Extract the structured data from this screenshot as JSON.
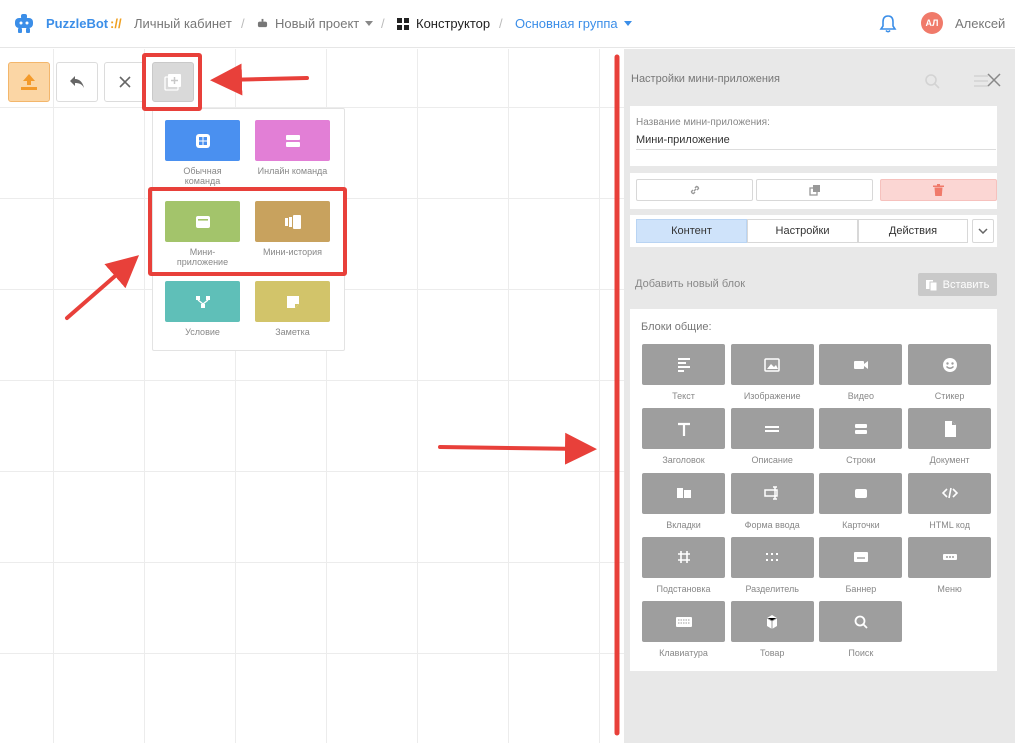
{
  "header": {
    "brand": "PuzzleBot",
    "brand_separator": "://",
    "breadcrumbs": [
      {
        "label": "Личный кабинет"
      },
      {
        "label": "Новый проект"
      },
      {
        "label": "Конструктор"
      },
      {
        "label": "Основная группа"
      }
    ],
    "avatar_initials": "АЛ",
    "user_name": "Алексей"
  },
  "palette": {
    "items": [
      {
        "label": "Обычная команда",
        "color": "#4a90f0",
        "icon": "grid-icon"
      },
      {
        "label": "Инлайн команда",
        "color": "#e27fd6",
        "icon": "inline-list-icon"
      },
      {
        "label": "Мини-приложение",
        "color": "#a3c46b",
        "icon": "window-icon"
      },
      {
        "label": "Мини-история",
        "color": "#c8a25e",
        "icon": "stories-icon"
      },
      {
        "label": "Условие",
        "color": "#5fbfb8",
        "icon": "branch-icon"
      },
      {
        "label": "Заметка",
        "color": "#d2c46a",
        "icon": "note-icon"
      }
    ]
  },
  "panel": {
    "title": "Настройки мини-приложения",
    "name_label": "Название мини-приложения:",
    "name_value": "Мини-приложение",
    "tabs": [
      "Контент",
      "Настройки",
      "Действия"
    ],
    "add_block_label": "Добавить новый блок",
    "paste_label": "Вставить",
    "blocks_title": "Блоки общие:",
    "blocks": [
      {
        "label": "Текст",
        "icon": "text-align-icon"
      },
      {
        "label": "Изображение",
        "icon": "image-icon"
      },
      {
        "label": "Видео",
        "icon": "video-icon"
      },
      {
        "label": "Стикер",
        "icon": "sticker-icon"
      },
      {
        "label": "Заголовок",
        "icon": "heading-icon"
      },
      {
        "label": "Описание",
        "icon": "description-icon"
      },
      {
        "label": "Строки",
        "icon": "rows-icon"
      },
      {
        "label": "Документ",
        "icon": "document-icon"
      },
      {
        "label": "Вкладки",
        "icon": "tabs-icon"
      },
      {
        "label": "Форма ввода",
        "icon": "input-form-icon"
      },
      {
        "label": "Карточки",
        "icon": "cards-icon"
      },
      {
        "label": "HTML код",
        "icon": "code-icon"
      },
      {
        "label": "Подстановка",
        "icon": "hash-icon"
      },
      {
        "label": "Разделитель",
        "icon": "divider-icon"
      },
      {
        "label": "Баннер",
        "icon": "banner-icon"
      },
      {
        "label": "Меню",
        "icon": "menu-icon"
      },
      {
        "label": "Клавиатура",
        "icon": "keyboard-icon"
      },
      {
        "label": "Товар",
        "icon": "product-icon"
      },
      {
        "label": "Поиск",
        "icon": "search-icon"
      }
    ]
  },
  "colors": {
    "brand": "#3b8ee8",
    "annotation_red": "#e8403a",
    "upload_button": "#fbd6a5",
    "active_tab": "#cfe3fa",
    "delete_button": "#fbd6d3"
  }
}
